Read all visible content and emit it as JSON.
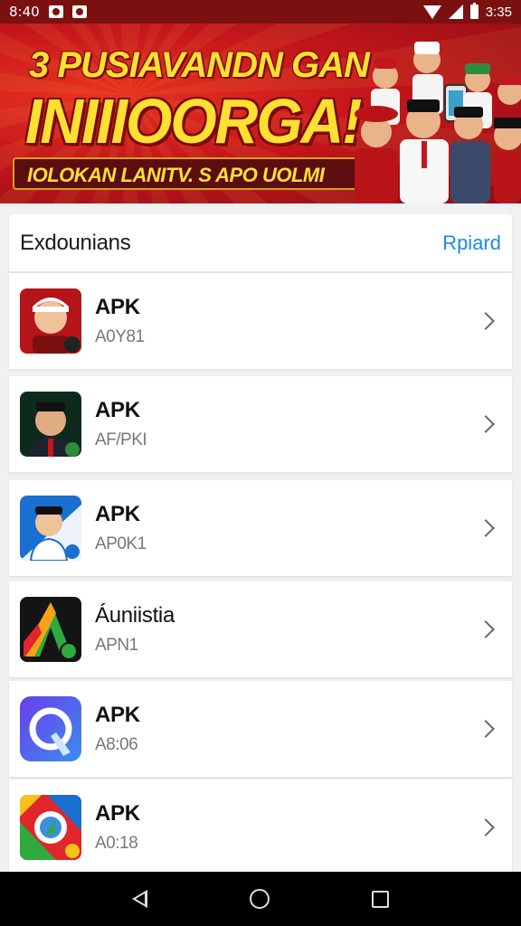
{
  "status_bar": {
    "time_left": "8:40",
    "time_right": "3:35",
    "icons": [
      "image-icon",
      "gallery-icon",
      "wifi-icon",
      "signal-icon",
      "battery-icon"
    ]
  },
  "banner": {
    "line1": "3 PUSIAVANDN GAN",
    "line2": "INIIIOORGA!",
    "strip": "IOLOKAN LANITV. S APO UOLMI",
    "colors": {
      "background": "#c4161c",
      "text": "#ffe032",
      "strip": "#5b0d10"
    }
  },
  "list": {
    "title": "Exdounians",
    "action": "Rpiard",
    "items": [
      {
        "name": "APK",
        "sub": "A0Y81",
        "icon": "red-hat-man-app-icon"
      },
      {
        "name": "APK",
        "sub": "AF/PKI",
        "icon": "suit-man-app-icon"
      },
      {
        "name": "APK",
        "sub": "AP0K1",
        "icon": "blue-sailor-man-app-icon"
      },
      {
        "name": "Áuniistia",
        "sub": "APN1",
        "icon": "green-a-app-icon"
      },
      {
        "name": "APK",
        "sub": "A8:06",
        "icon": "purple-q-app-icon"
      },
      {
        "name": "APK",
        "sub": "A0:18",
        "icon": "multicolor-compass-app-icon"
      }
    ]
  },
  "nav_bar": {
    "icons": [
      "back-icon",
      "home-icon",
      "recents-icon"
    ]
  }
}
